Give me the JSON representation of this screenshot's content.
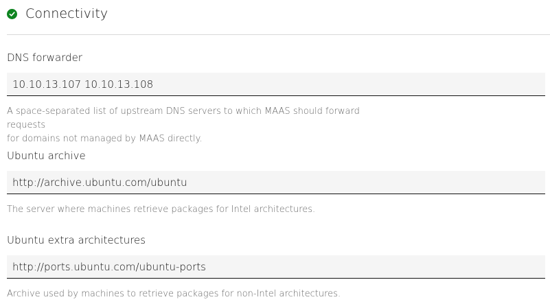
{
  "section": {
    "title": "Connectivity",
    "status_icon": "check-circle-icon",
    "status_color": "#0e8420"
  },
  "fields": [
    {
      "label": "DNS forwarder",
      "value": "10.10.13.107 10.10.13.108",
      "help_line1": "A space-separated list of upstream DNS servers to which MAAS should forward requests",
      "help_line2": "for domains not managed by MAAS directly."
    },
    {
      "label": "Ubuntu archive",
      "value": "http://archive.ubuntu.com/ubuntu",
      "help_line1": "The server where machines retrieve packages for Intel architectures."
    },
    {
      "label": "Ubuntu extra architectures",
      "value": "http://ports.ubuntu.com/ubuntu-ports",
      "help_line1": "Archive used by machines to retrieve packages for non-Intel architectures."
    }
  ]
}
